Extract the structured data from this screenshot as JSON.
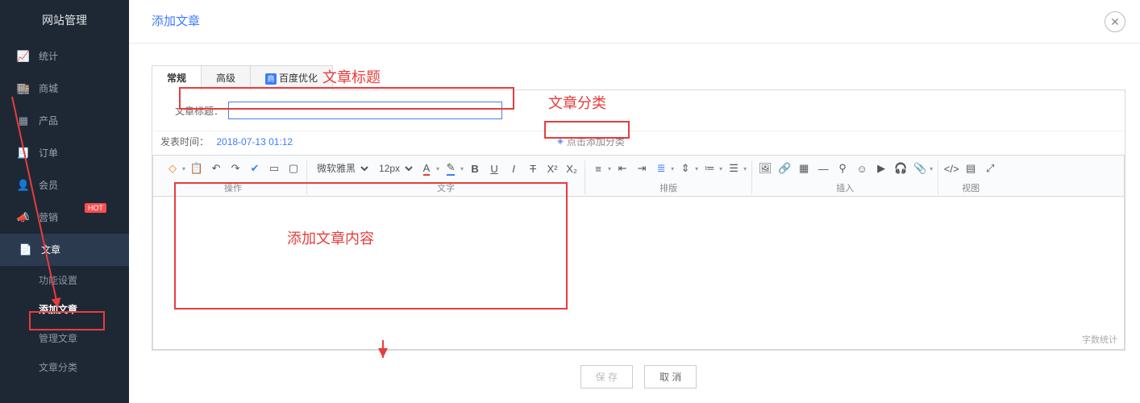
{
  "sidebar": {
    "title": "网站管理",
    "items": [
      {
        "label": "统计",
        "icon": "chart-line-icon"
      },
      {
        "label": "商城",
        "icon": "store-icon"
      },
      {
        "label": "产品",
        "icon": "grid-icon"
      },
      {
        "label": "订单",
        "icon": "receipt-icon"
      },
      {
        "label": "会员",
        "icon": "user-icon"
      },
      {
        "label": "营销",
        "icon": "megaphone-icon",
        "badge": "HOT"
      },
      {
        "label": "文章",
        "icon": "document-icon",
        "active": true
      }
    ],
    "sub": [
      {
        "label": "功能设置"
      },
      {
        "label": "添加文章",
        "selected": true
      },
      {
        "label": "管理文章"
      },
      {
        "label": "文章分类"
      }
    ]
  },
  "page": {
    "title": "添加文章"
  },
  "tabs": [
    {
      "label": "常规",
      "active": true
    },
    {
      "label": "高级"
    },
    {
      "label": "百度优化",
      "icon": true
    }
  ],
  "form": {
    "title_label": "文章标题：",
    "title_value": "",
    "publish_label": "发表时间：",
    "publish_value": "2018-07-13 01:12",
    "category_link": "点击添加分类"
  },
  "toolbar": {
    "font_family": "微软雅黑",
    "font_size": "12px",
    "groups": {
      "ops": "操作",
      "text": "文字",
      "layout": "排版",
      "insert": "插入",
      "view": "视图"
    }
  },
  "editor": {
    "word_count_label": "字数统计"
  },
  "buttons": {
    "save": "保 存",
    "cancel": "取 消"
  },
  "annotations": {
    "title": "文章标题",
    "category": "文章分类",
    "content": "添加文章内容"
  }
}
